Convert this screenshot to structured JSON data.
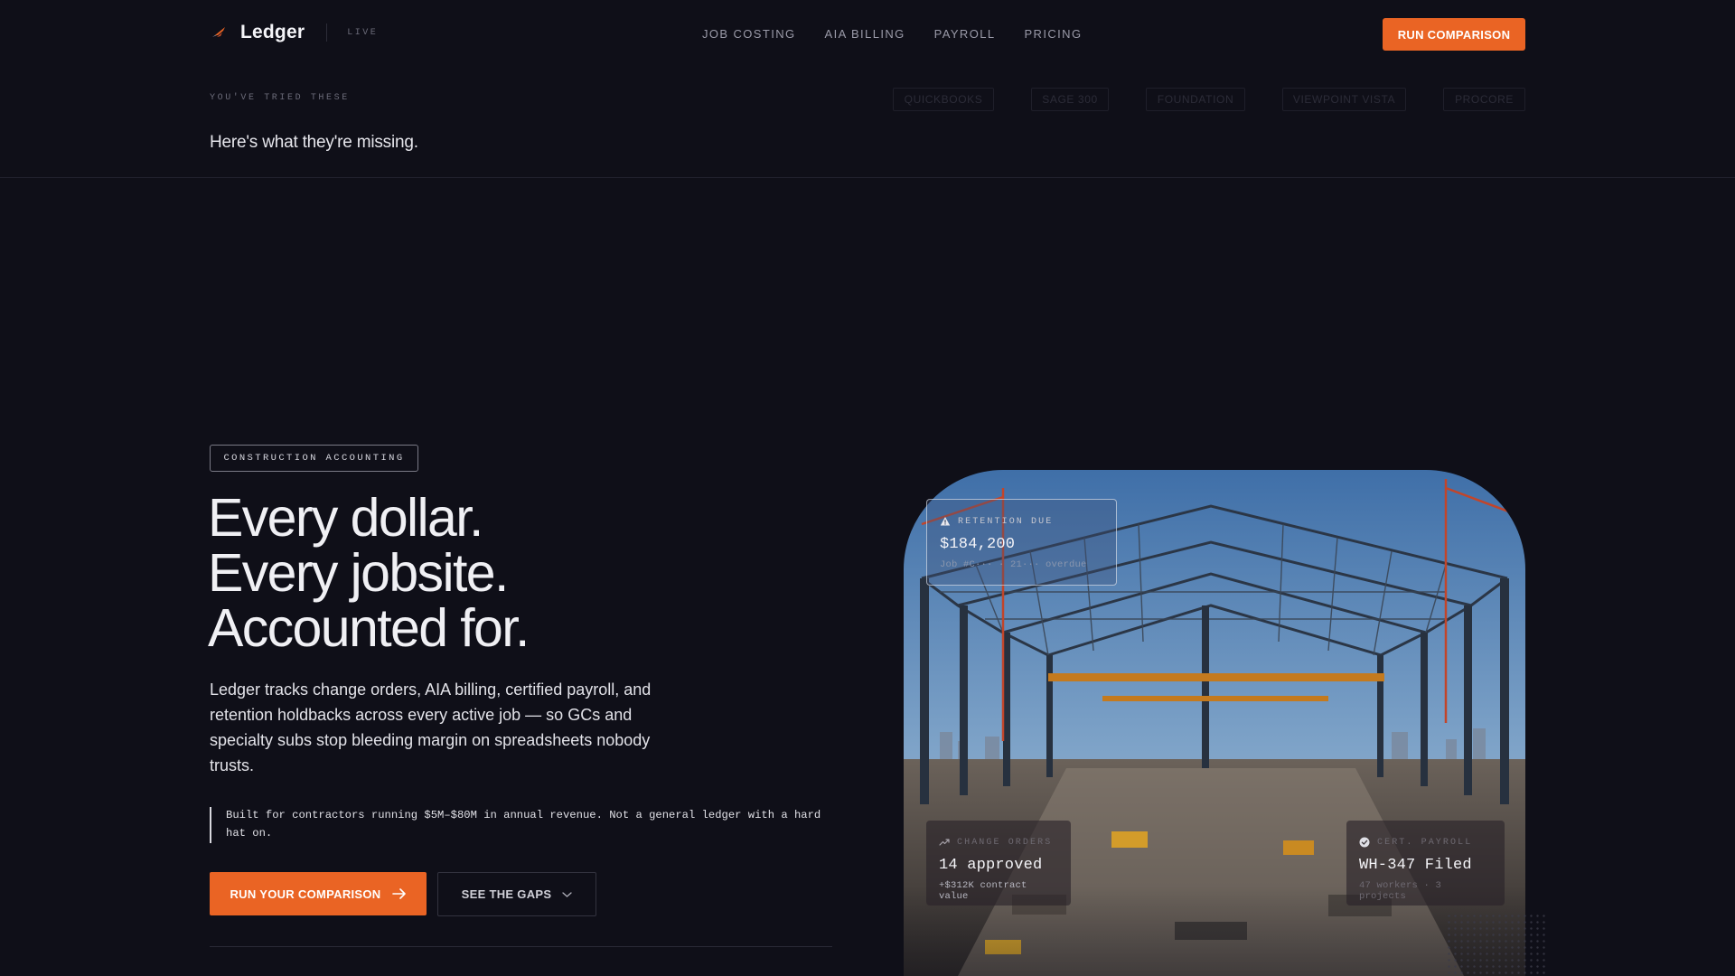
{
  "brand": {
    "name": "Ledger",
    "status": "LIVE"
  },
  "nav": {
    "items": [
      {
        "label": "JOB COSTING"
      },
      {
        "label": "AIA BILLING"
      },
      {
        "label": "PAYROLL"
      },
      {
        "label": "PRICING"
      }
    ],
    "cta_label": "RUN COMPARISON"
  },
  "tried": {
    "eyebrow": "YOU'VE TRIED THESE",
    "subhead": "Here's what they're missing.",
    "competitors": [
      "QUICKBOOKS",
      "SAGE 300",
      "FOUNDATION",
      "VIEWPOINT VISTA",
      "PROCORE"
    ]
  },
  "hero": {
    "tag": "CONSTRUCTION ACCOUNTING",
    "headline": [
      "Every dollar.",
      "Every jobsite.",
      "Accounted for."
    ],
    "lede": "Ledger tracks change orders, AIA billing, certified payroll, and retention holdbacks across every active job — so GCs and specialty subs stop bleeding margin on spreadsheets nobody trusts.",
    "note": "Built for contractors running $5M–$80M in annual revenue. Not a general ledger with a hard hat on.",
    "primary_cta": "RUN YOUR COMPARISON",
    "secondary_cta": "SEE THE GAPS"
  },
  "cards": {
    "retention": {
      "label": "RETENTION DUE",
      "value": "$184,200",
      "meta": "Job #C··· · 21··· overdue"
    },
    "change_orders": {
      "label": "CHANGE ORDERS",
      "value": "14 approved",
      "meta": "+$312K contract value"
    },
    "payroll": {
      "label": "CERT. PAYROLL",
      "value": "WH-347 Filed",
      "meta": "47 workers · 3 projects"
    }
  },
  "colors": {
    "accent": "#ea6424",
    "background": "#0f0f18"
  },
  "icons": [
    "brand-mark-icon",
    "arrow-right-icon",
    "chevron-down-icon",
    "warning-triangle-icon",
    "trend-up-icon",
    "check-circle-icon"
  ]
}
